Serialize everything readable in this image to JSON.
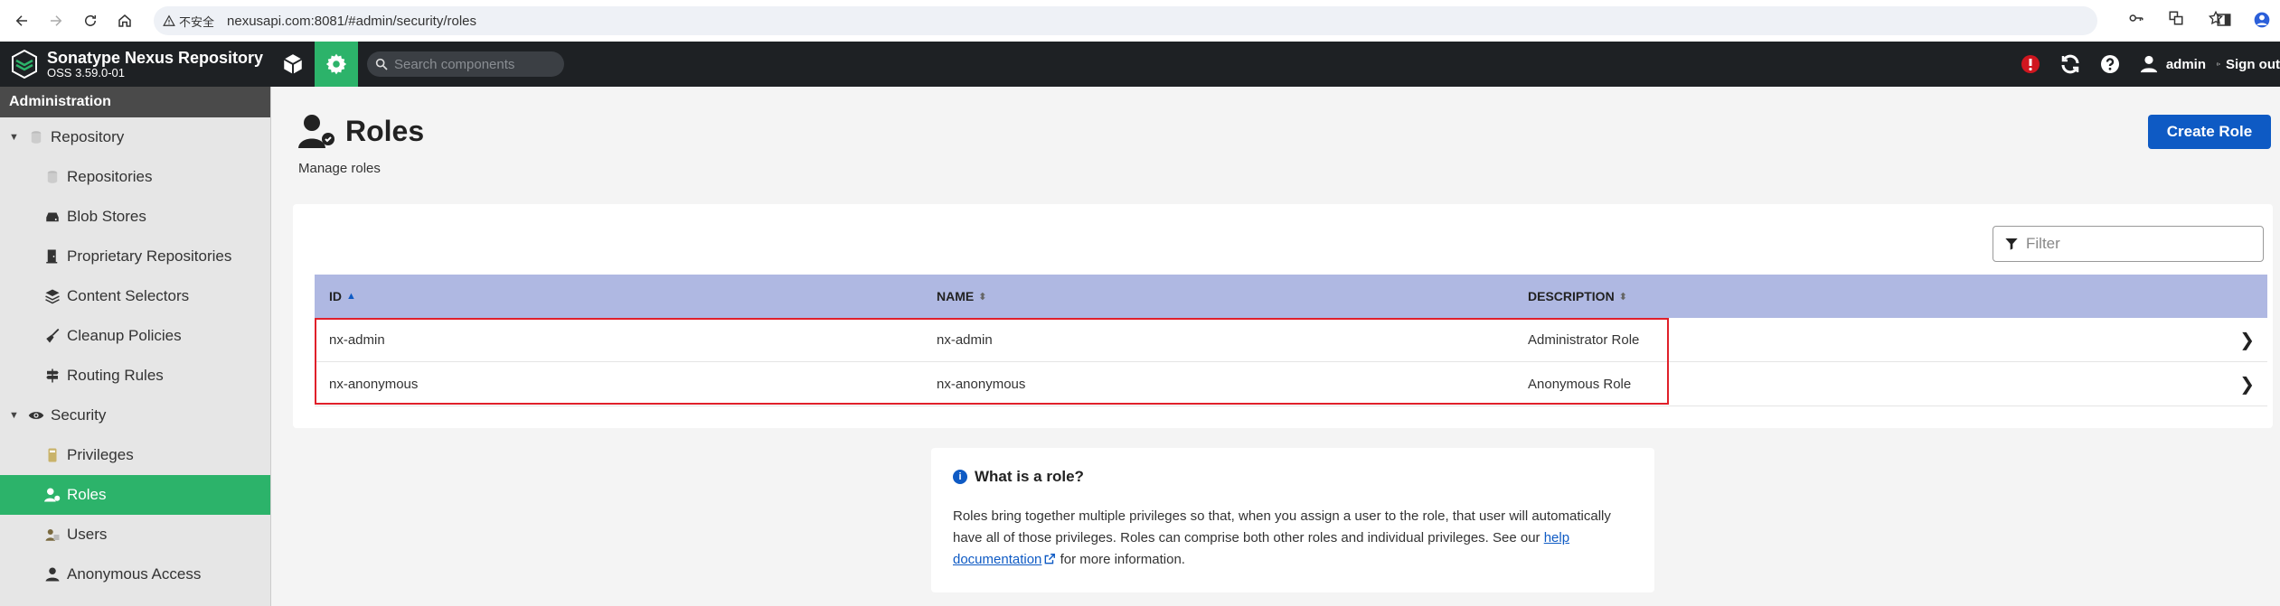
{
  "browser": {
    "security_label": "不安全",
    "url": "nexusapi.com:8081/#admin/security/roles"
  },
  "header": {
    "app_title": "Sonatype Nexus Repository",
    "version": "OSS 3.59.0-01",
    "search_placeholder": "Search components",
    "user": "admin",
    "signout": "Sign out"
  },
  "sidebar": {
    "heading": "Administration",
    "items": [
      {
        "label": "Repository",
        "icon": "database-icon",
        "type": "group"
      },
      {
        "label": "Repositories",
        "icon": "database-icon",
        "type": "child"
      },
      {
        "label": "Blob Stores",
        "icon": "drive-icon",
        "type": "child"
      },
      {
        "label": "Proprietary Repositories",
        "icon": "door-icon",
        "type": "child"
      },
      {
        "label": "Content Selectors",
        "icon": "layers-icon",
        "type": "child"
      },
      {
        "label": "Cleanup Policies",
        "icon": "broom-icon",
        "type": "child"
      },
      {
        "label": "Routing Rules",
        "icon": "signpost-icon",
        "type": "child"
      },
      {
        "label": "Security",
        "icon": "eye-icon",
        "type": "group"
      },
      {
        "label": "Privileges",
        "icon": "medal-icon",
        "type": "child"
      },
      {
        "label": "Roles",
        "icon": "user-role-icon",
        "type": "child",
        "selected": true
      },
      {
        "label": "Users",
        "icon": "users-icon",
        "type": "child"
      },
      {
        "label": "Anonymous Access",
        "icon": "user-icon",
        "type": "child"
      }
    ]
  },
  "main": {
    "title": "Roles",
    "subtitle": "Manage roles",
    "create_button": "Create Role",
    "filter_placeholder": "Filter",
    "columns": [
      "ID",
      "NAME",
      "DESCRIPTION"
    ],
    "rows": [
      {
        "id": "nx-admin",
        "name": "nx-admin",
        "description": "Administrator Role"
      },
      {
        "id": "nx-anonymous",
        "name": "nx-anonymous",
        "description": "Anonymous Role"
      }
    ],
    "info": {
      "title": "What is a role?",
      "text_before": "Roles bring together multiple privileges so that, when you assign a user to the role, that user will automatically have all of those privileges. Roles can comprise both other roles and individual privileges. See our ",
      "link": "help documentation",
      "text_after": " for more information."
    }
  },
  "colors": {
    "accent_green": "#2cb36a",
    "primary_blue": "#0e5ac4",
    "header_dark": "#1e2124",
    "table_head": "#afb8e2",
    "highlight_red": "#e0202a",
    "alert_red": "#d0161f"
  }
}
